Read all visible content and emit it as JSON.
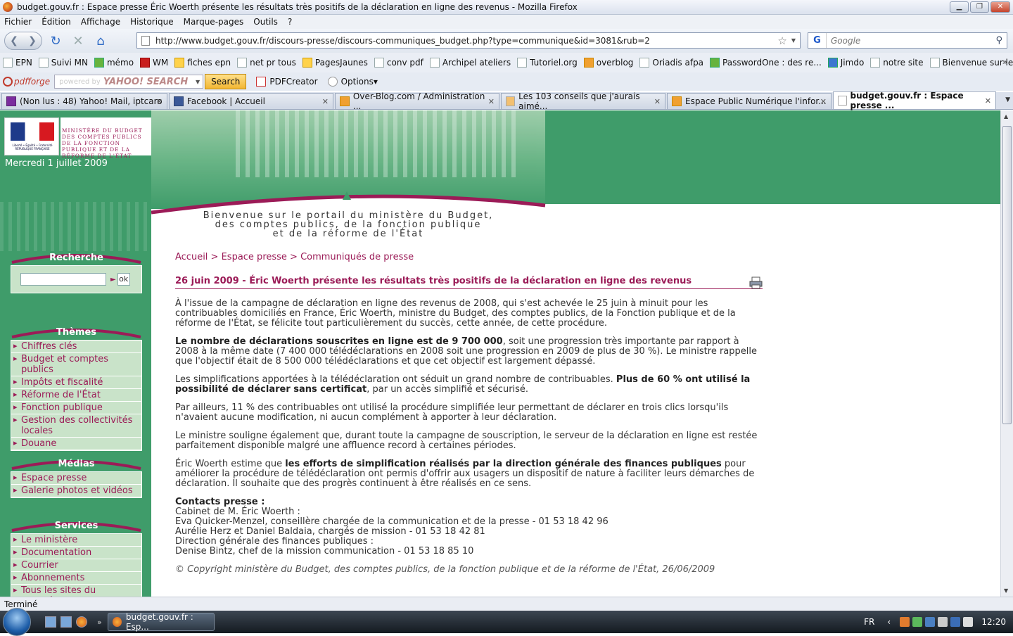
{
  "window": {
    "title": "budget.gouv.fr : Espace presse Éric Woerth présente les résultats très positifs de la déclaration en ligne des revenus - Mozilla Firefox"
  },
  "menu": [
    "Fichier",
    "Édition",
    "Affichage",
    "Historique",
    "Marque-pages",
    "Outils",
    "?"
  ],
  "nav": {
    "url": "http://www.budget.gouv.fr/discours-presse/discours-communiques_budget.php?type=communique&id=3081&rub=2",
    "search_placeholder": "Google"
  },
  "bookmarks": [
    "EPN",
    "Suivi MN",
    "mémo",
    "WM",
    "fiches epn",
    "net pr tous",
    "PagesJaunes",
    "conv pdf",
    "Archipel ateliers",
    "Tutoriel.org",
    "overblog",
    "Oriadis afpa",
    "PasswordOne : des re...",
    "Jimdo",
    "notre site",
    "Bienvenue sur le site d..."
  ],
  "toolbar": {
    "pdfforge": "pdfforge",
    "yahoo_powered": "powered by",
    "yahoo_logo": "YAHOO! SEARCH",
    "search_btn": "Search",
    "pdfcreator": "PDFCreator",
    "options": "Options"
  },
  "tabs": [
    {
      "label": "(Non lus : 48) Yahoo! Mail, iptcaro"
    },
    {
      "label": "Facebook | Accueil"
    },
    {
      "label": "Over-Blog.com / Administration ..."
    },
    {
      "label": "Les 103 conseils que j'aurais aimé..."
    },
    {
      "label": "Espace Public Numérique l'infor..."
    },
    {
      "label": "budget.gouv.fr : Espace presse ..."
    }
  ],
  "site": {
    "ministry": "Ministère du Budget des comptes publics de la fonction publique et de la réforme de l'État",
    "marianne_caption": "Liberté • Égalité • Fraternité RÉPUBLIQUE FRANÇAISE",
    "date": "Mercredi 1 juillet 2009",
    "welcome_1": "Bienvenue sur le portail du ministère du Budget,",
    "welcome_2": "des comptes publics, de la fonction publique",
    "welcome_3": "et de la réforme de l'État",
    "search_title": "Recherche",
    "search_ok": "ok",
    "themes_title": "Thèmes",
    "themes": [
      "Chiffres clés",
      "Budget et comptes publics",
      "Impôts et fiscalité",
      "Réforme de l'État",
      "Fonction publique",
      "Gestion des collectivités locales",
      "Douane"
    ],
    "medias_title": "Médias",
    "medias": [
      "Espace presse",
      "Galerie photos et vidéos"
    ],
    "services_title": "Services",
    "services": [
      "Le ministère",
      "Documentation",
      "Courrier",
      "Abonnements",
      "Tous les sites du ministère"
    ],
    "breadcrumb": "Accueil > Espace presse > Communiqués de presse",
    "article_title": "26 juin 2009 - Éric Woerth présente les résultats très positifs de la déclaration en ligne des revenus",
    "p1": "À l'issue de la campagne de déclaration en ligne des revenus de 2008, qui s'est achevée le 25 juin à minuit pour les contribuables domiciliés en France, Éric Woerth, ministre du Budget, des comptes publics, de la Fonction publique et de la réforme de l'État, se félicite tout particulièrement du succès, cette année, de cette procédure.",
    "p2_bold": "Le nombre de déclarations souscrites en ligne est de 9 700 000",
    "p2_rest": ", soit une progression très importante par rapport à 2008 à la même date (7 400 000 télédéclarations en 2008 soit une progression en 2009 de plus de 30 %). Le ministre rappelle que l'objectif était de 8 500 000 télédéclarations et que cet objectif est largement dépassé.",
    "p3_start": "Les simplifications apportées à la télédéclaration ont séduit un grand nombre de contribuables. ",
    "p3_bold": "Plus de 60 % ont utilisé la possibilité de déclarer sans certificat",
    "p3_end": ", par un accès simplifié et sécurisé.",
    "p4": "Par ailleurs, 11 % des contribuables ont utilisé la procédure simplifiée leur permettant de déclarer en trois clics lorsqu'ils n'avaient aucune modification, ni aucun complément à apporter à leur déclaration.",
    "p5": "Le ministre souligne également que, durant toute la campagne de souscription, le serveur de la déclaration en ligne est restée parfaitement disponible malgré une affluence record à certaines périodes.",
    "p6_start": "Éric Woerth estime que ",
    "p6_bold": "les efforts de simplification réalisés par la direction générale des finances publiques",
    "p6_end": " pour améliorer la procédure de télédéclaration ont permis d'offrir aux usagers un dispositif de nature à faciliter leurs démarches de déclaration. Il souhaite que des progrès continuent à être réalisés en ce sens.",
    "contacts_title": "Contacts presse :",
    "contacts": [
      "Cabinet de M. Éric Woerth :",
      "Eva Quicker-Menzel, conseillère chargée de la communication et de la presse - 01 53 18 42 96",
      "Aurélie Herz et Daniel Baldaia, chargés de mission - 01 53 18 42 81",
      "Direction générale des finances publiques :",
      "Denise Bintz, chef de la mission communication - 01 53 18 85 10"
    ],
    "copyright": "© Copyright ministère du Budget, des comptes publics, de la fonction publique et de la réforme de l'État, 26/06/2009"
  },
  "status": "Terminé",
  "taskbar": {
    "task": "budget.gouv.fr : Esp...",
    "lang": "FR",
    "clock": "12:20"
  }
}
